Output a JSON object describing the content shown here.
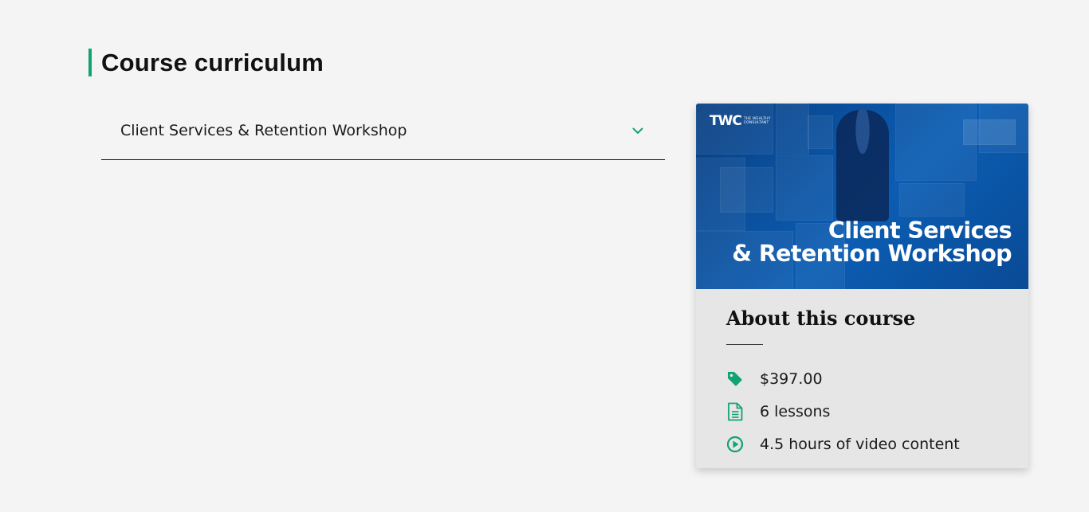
{
  "curriculum": {
    "heading": "Course curriculum",
    "accordion": {
      "title": "Client Services & Retention Workshop",
      "chevron_icon": "chevron-down-icon"
    }
  },
  "course_card": {
    "banner": {
      "logo_mark": "TWC",
      "logo_sub": "THE WEALTHY CONSULTANT",
      "headline_line1": "Client Services",
      "headline_line2": "& Retention Workshop"
    },
    "about_title": "About this course",
    "stats": {
      "price": {
        "icon": "price-tag-icon",
        "text": "$397.00"
      },
      "lessons": {
        "icon": "document-icon",
        "text": "6 lessons"
      },
      "video": {
        "icon": "play-circle-icon",
        "text": "4.5 hours of video content"
      }
    }
  },
  "colors": {
    "accent": "#11a373",
    "page_background": "#f4f4f4",
    "card_background": "#e6e6e6",
    "banner_blue": "#0b5db3"
  }
}
